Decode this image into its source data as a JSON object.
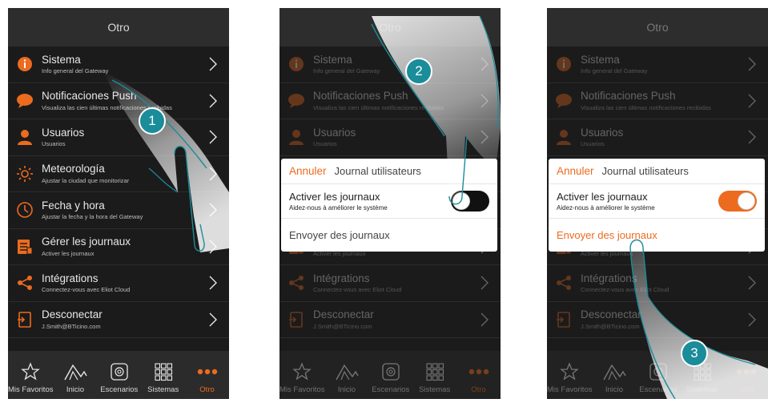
{
  "colors": {
    "accent": "#ec6b1f",
    "teal": "#1a8c9a",
    "background": "#1b1b1b"
  },
  "header_title": "Otro",
  "menu": [
    {
      "title": "Sistema",
      "subtitle": "Info general del Gateway",
      "icon": "info-icon"
    },
    {
      "title": "Notificaciones Push",
      "subtitle": "Visualiza las cien últimas notificaciones recibidas",
      "icon": "chat-bubble-icon"
    },
    {
      "title": "Usuarios",
      "subtitle": "Usuarios",
      "icon": "user-icon"
    },
    {
      "title": "Meteorología",
      "subtitle": "Ajustar la ciudad que monitorizar",
      "icon": "sun-icon"
    },
    {
      "title": "Fecha y hora",
      "subtitle": "Ajustar la fecha y la hora del Gateway",
      "icon": "clock-icon"
    },
    {
      "title": "Gérer les journaux",
      "subtitle": "Activer les journaux",
      "icon": "log-list-icon"
    },
    {
      "title": "Intégrations",
      "subtitle": "Connectez-vous avec Eliot Cloud",
      "icon": "share-icon"
    },
    {
      "title": "Desconectar",
      "subtitle": "J.Smith@BTicino.com",
      "icon": "logout-icon"
    }
  ],
  "tabs": [
    {
      "label": "Mis Favoritos",
      "icon": "star-icon"
    },
    {
      "label": "Inicio",
      "icon": "home-icon"
    },
    {
      "label": "Escenarios",
      "icon": "scenario-icon"
    },
    {
      "label": "Sistemas",
      "icon": "grid-icon"
    },
    {
      "label": "Otro",
      "icon": "more-dots-icon"
    }
  ],
  "dialog": {
    "cancel": "Annuler",
    "title": "Journal utilisateurs",
    "toggle_title": "Activer les journaux",
    "toggle_subtitle": "Aidez-nous à améliorer le système",
    "send": "Envoyer des journaux"
  },
  "screens": [
    {
      "step": "1",
      "toggle_on": false
    },
    {
      "step": "2",
      "toggle_on": false
    },
    {
      "step": "3",
      "toggle_on": true
    }
  ]
}
